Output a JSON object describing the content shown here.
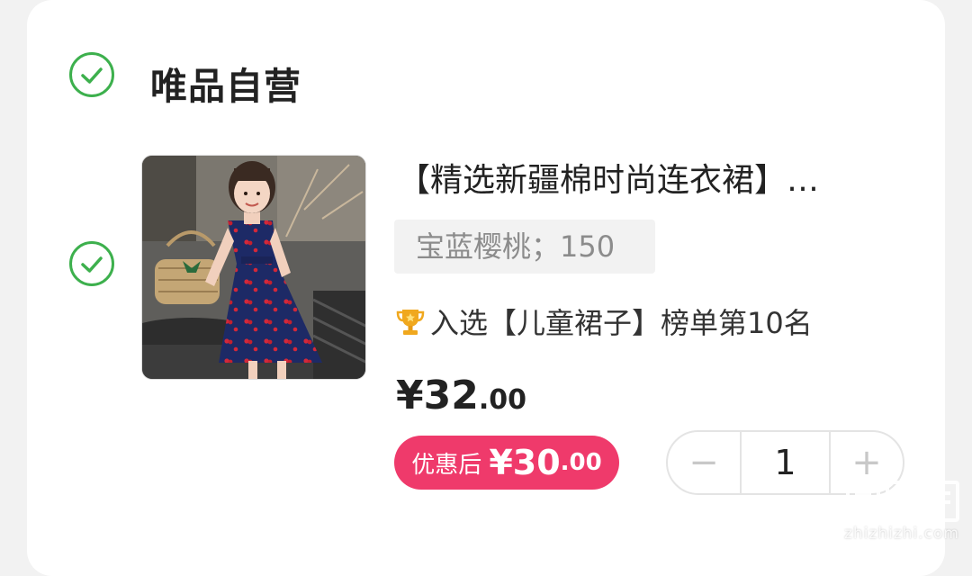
{
  "shop": {
    "name": "唯品自营",
    "selected": true
  },
  "item": {
    "selected": true,
    "image_desc_icon": "product-image",
    "title": "【精选新疆棉时尚连衣裙】…",
    "sku": "宝蓝樱桃；150",
    "rank_icon": "trophy-icon",
    "rank_text": "入选【儿童裙子】榜单第10名",
    "price_int": "¥32",
    "price_dec": ".00",
    "promo_label": "优惠后",
    "promo_int": "¥30",
    "promo_dec": ".00",
    "quantity": "1",
    "minus": "−",
    "plus": "+"
  },
  "watermark": {
    "text": "zhizhizhi.com"
  },
  "colors": {
    "check": "#3db04d",
    "promo": "#ef3a6b",
    "trophy": "#f0a81e"
  }
}
